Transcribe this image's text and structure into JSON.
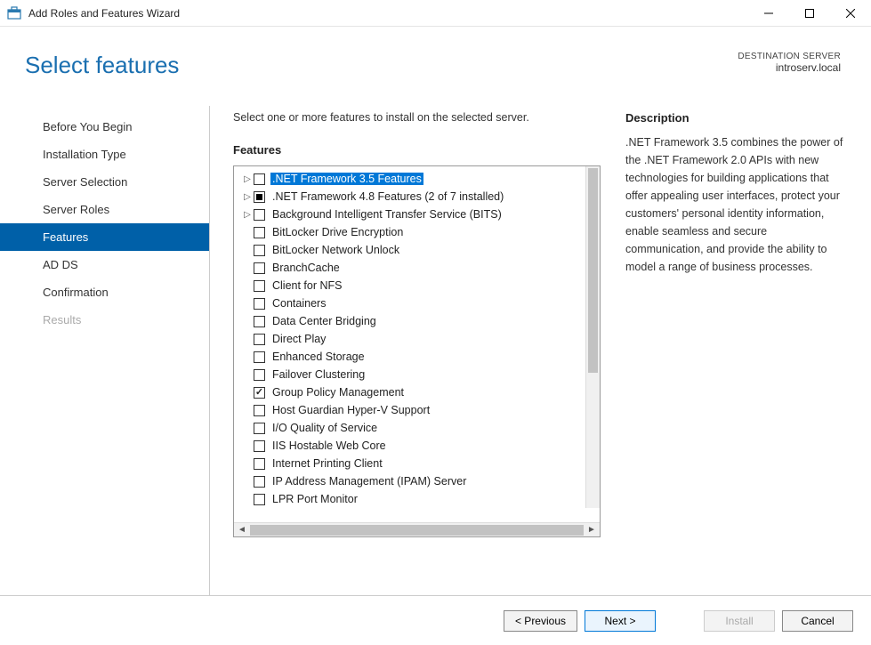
{
  "window": {
    "title": "Add Roles and Features Wizard"
  },
  "header": {
    "page_title": "Select features",
    "destination_label": "DESTINATION SERVER",
    "destination_value": "introserv.local"
  },
  "sidebar": {
    "items": [
      {
        "label": "Before You Begin",
        "state": "normal"
      },
      {
        "label": "Installation Type",
        "state": "normal"
      },
      {
        "label": "Server Selection",
        "state": "normal"
      },
      {
        "label": "Server Roles",
        "state": "normal"
      },
      {
        "label": "Features",
        "state": "active"
      },
      {
        "label": "AD DS",
        "state": "normal"
      },
      {
        "label": "Confirmation",
        "state": "normal"
      },
      {
        "label": "Results",
        "state": "disabled"
      }
    ]
  },
  "main": {
    "instruction": "Select one or more features to install on the selected server.",
    "features_heading": "Features",
    "description_heading": "Description",
    "description_text": ".NET Framework 3.5 combines the power of the .NET Framework 2.0 APIs with new technologies for building applications that offer appealing user interfaces, protect your customers' personal identity information, enable seamless and secure communication, and provide the ability to model a range of business processes.",
    "features": [
      {
        "label": ".NET Framework 3.5 Features",
        "expandable": true,
        "check": "unchecked",
        "selected": true
      },
      {
        "label": ".NET Framework 4.8 Features (2 of 7 installed)",
        "expandable": true,
        "check": "mixed"
      },
      {
        "label": "Background Intelligent Transfer Service (BITS)",
        "expandable": true,
        "check": "unchecked"
      },
      {
        "label": "BitLocker Drive Encryption",
        "expandable": false,
        "check": "unchecked"
      },
      {
        "label": "BitLocker Network Unlock",
        "expandable": false,
        "check": "unchecked"
      },
      {
        "label": "BranchCache",
        "expandable": false,
        "check": "unchecked"
      },
      {
        "label": "Client for NFS",
        "expandable": false,
        "check": "unchecked"
      },
      {
        "label": "Containers",
        "expandable": false,
        "check": "unchecked"
      },
      {
        "label": "Data Center Bridging",
        "expandable": false,
        "check": "unchecked"
      },
      {
        "label": "Direct Play",
        "expandable": false,
        "check": "unchecked"
      },
      {
        "label": "Enhanced Storage",
        "expandable": false,
        "check": "unchecked"
      },
      {
        "label": "Failover Clustering",
        "expandable": false,
        "check": "unchecked"
      },
      {
        "label": "Group Policy Management",
        "expandable": false,
        "check": "checked"
      },
      {
        "label": "Host Guardian Hyper-V Support",
        "expandable": false,
        "check": "unchecked"
      },
      {
        "label": "I/O Quality of Service",
        "expandable": false,
        "check": "unchecked"
      },
      {
        "label": "IIS Hostable Web Core",
        "expandable": false,
        "check": "unchecked"
      },
      {
        "label": "Internet Printing Client",
        "expandable": false,
        "check": "unchecked"
      },
      {
        "label": "IP Address Management (IPAM) Server",
        "expandable": false,
        "check": "unchecked"
      },
      {
        "label": "LPR Port Monitor",
        "expandable": false,
        "check": "unchecked"
      }
    ]
  },
  "footer": {
    "previous": "< Previous",
    "next": "Next >",
    "install": "Install",
    "cancel": "Cancel"
  }
}
